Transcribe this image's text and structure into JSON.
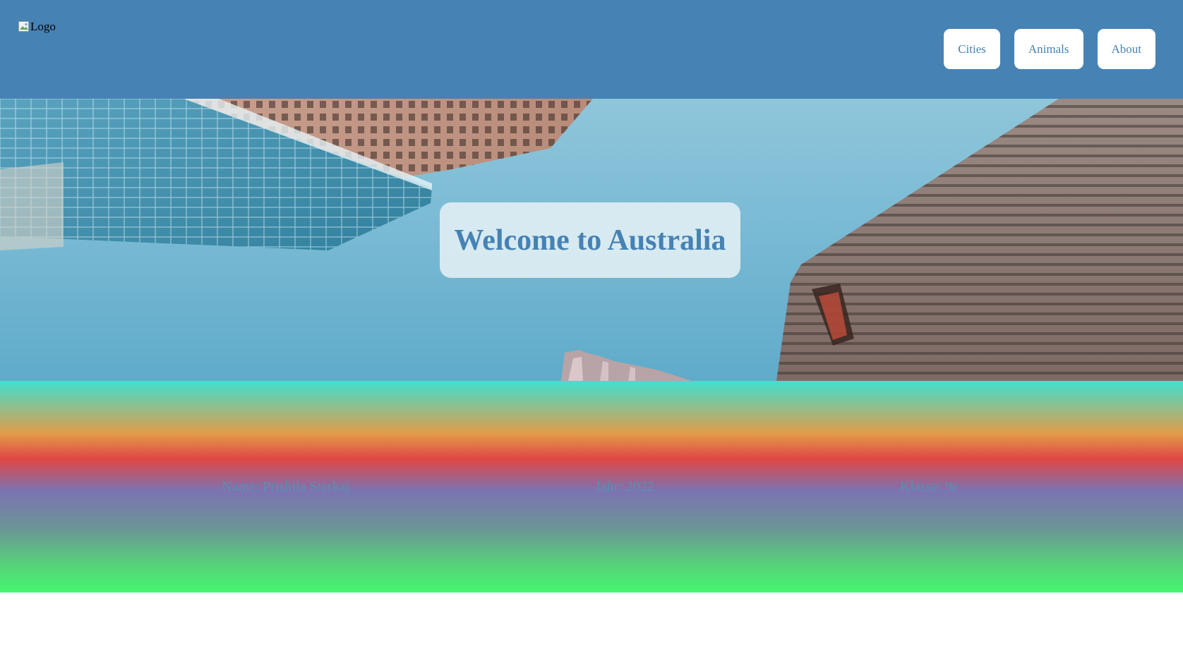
{
  "header": {
    "logo_alt": "Logo",
    "nav": [
      {
        "label": "Cities"
      },
      {
        "label": "Animals"
      },
      {
        "label": "About"
      }
    ]
  },
  "hero": {
    "title": "Welcome to Australia"
  },
  "footer": {
    "name": "Name: Prishila Sterkaj",
    "year": "Jahr: 2022",
    "class": "Klasse: 9e"
  },
  "colors": {
    "brand": "#4682b4",
    "nav_button_bg": "#ffffff",
    "footer_text": "#5b90b0"
  }
}
